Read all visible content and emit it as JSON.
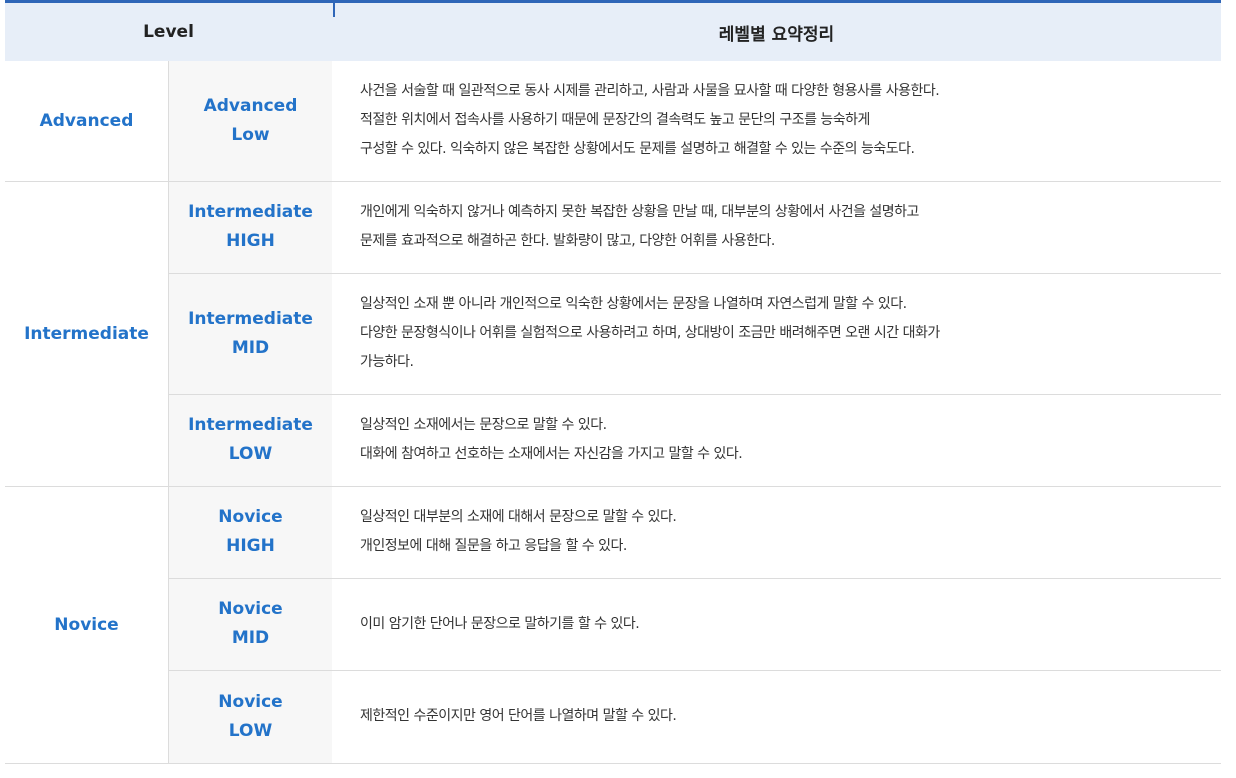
{
  "header": {
    "level": "Level",
    "summary": "레벨별 요약정리"
  },
  "groups": [
    {
      "name": "Advanced",
      "rows": [
        {
          "sub1": "Advanced",
          "sub2": "Low",
          "lines": [
            "사건을 서술할 때 일관적으로 동사 시제를 관리하고, 사람과 사물을 묘사할 때 다양한 형용사를 사용한다.",
            "적절한 위치에서 접속사를 사용하기 때문에 문장간의 결속력도 높고 문단의 구조를 능숙하게",
            "구성할 수 있다. 익숙하지 않은 복잡한 상황에서도 문제를 설명하고 해결할 수 있는 수준의 능숙도다."
          ]
        }
      ]
    },
    {
      "name": "Intermediate",
      "rows": [
        {
          "sub1": "Intermediate",
          "sub2": "HIGH",
          "lines": [
            "개인에게 익숙하지 않거나 예측하지 못한 복잡한 상황을 만날 때, 대부분의 상황에서 사건을 설명하고",
            "문제를 효과적으로 해결하곤 한다. 발화량이 많고, 다양한 어휘를 사용한다."
          ]
        },
        {
          "sub1": "Intermediate",
          "sub2": "MID",
          "lines": [
            "일상적인 소재 뿐 아니라 개인적으로 익숙한 상황에서는 문장을 나열하며 자연스럽게 말할 수 있다.",
            "다양한 문장형식이나 어휘를 실험적으로 사용하려고 하며, 상대방이 조금만 배려해주면 오랜 시간 대화가",
            "가능하다."
          ]
        },
        {
          "sub1": "Intermediate",
          "sub2": "LOW",
          "lines": [
            "일상적인 소재에서는 문장으로 말할 수 있다.",
            "대화에 참여하고 선호하는 소재에서는 자신감을 가지고 말할 수 있다."
          ]
        }
      ]
    },
    {
      "name": "Novice",
      "rows": [
        {
          "sub1": "Novice",
          "sub2": "HIGH",
          "lines": [
            "일상적인 대부분의 소재에 대해서 문장으로 말할 수 있다.",
            "개인정보에 대해 질문을 하고 응답을 할 수 있다."
          ]
        },
        {
          "sub1": "Novice",
          "sub2": "MID",
          "lines": [
            "이미 암기한 단어나 문장으로 말하기를 할 수 있다."
          ]
        },
        {
          "sub1": "Novice",
          "sub2": "LOW",
          "lines": [
            "제한적인 수준이지만 영어 단어를 나열하며 말할 수 있다."
          ]
        }
      ]
    }
  ]
}
